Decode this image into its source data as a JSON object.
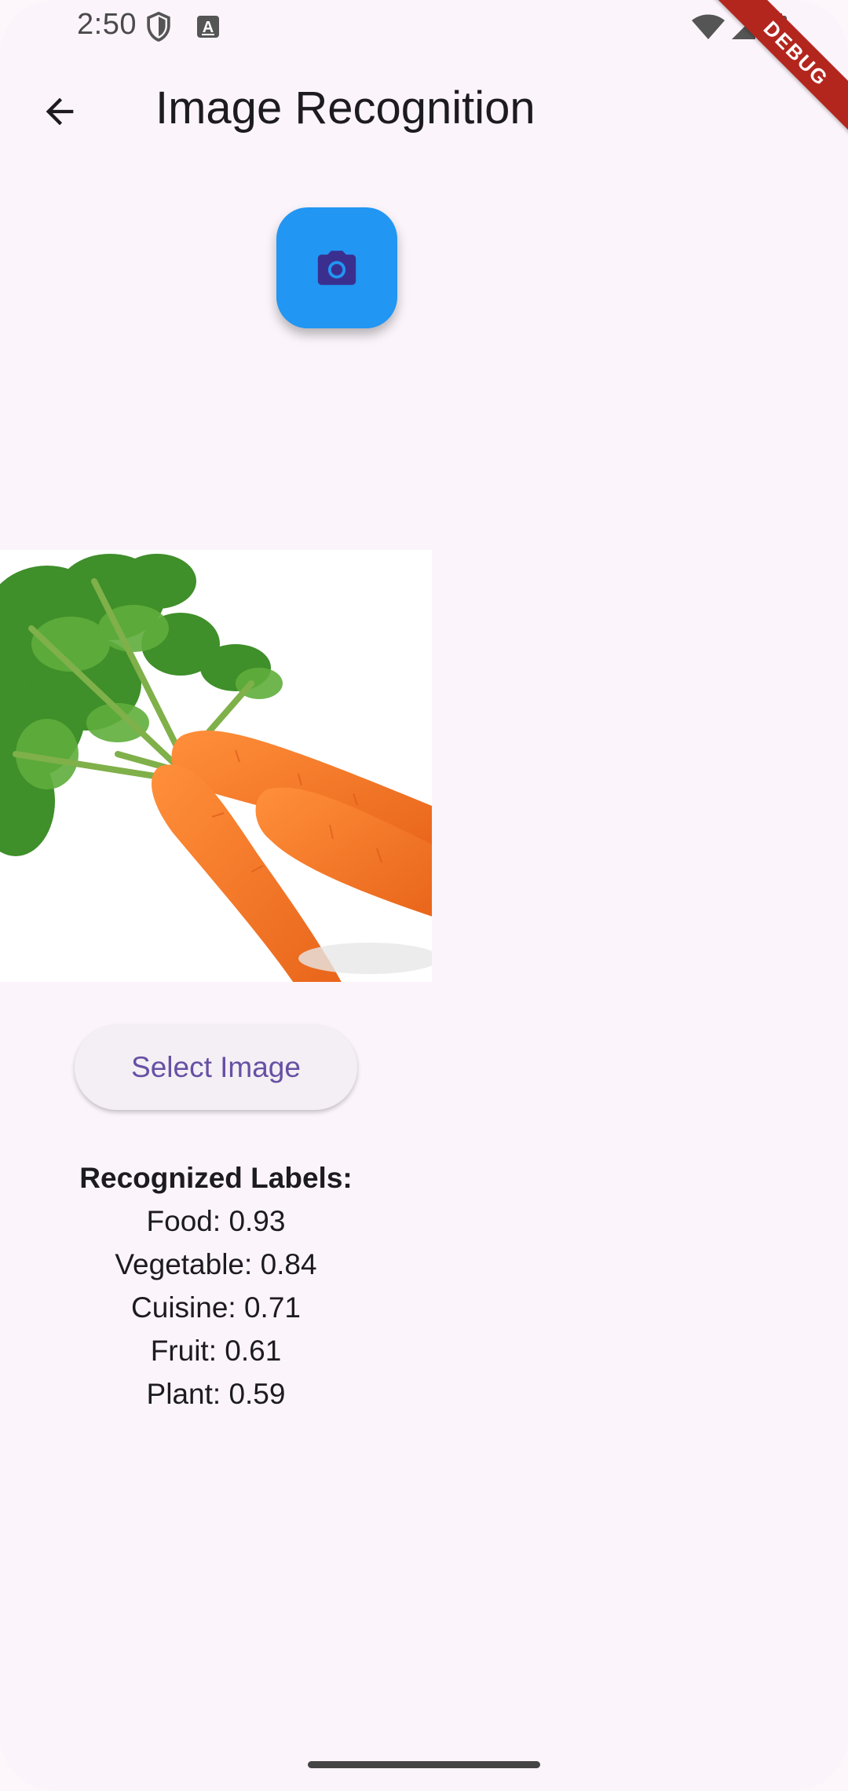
{
  "status_bar": {
    "time": "2:50",
    "icons": [
      "shield-icon",
      "a-icon",
      "wifi-icon",
      "signal-icon",
      "battery-icon"
    ]
  },
  "debug_banner": "DEBUG",
  "app_bar": {
    "title": "Image Recognition",
    "back_icon": "arrow-back-icon"
  },
  "camera_button": {
    "icon": "camera-icon",
    "color": "#2196f3"
  },
  "image": {
    "subject": "carrots"
  },
  "select_button": {
    "label": "Select Image"
  },
  "results": {
    "heading": "Recognized Labels:",
    "labels": [
      "Food: 0.93",
      "Vegetable: 0.84",
      "Cuisine: 0.71",
      "Fruit: 0.61",
      "Plant: 0.59"
    ]
  },
  "colors": {
    "background": "#fbf5fb",
    "accent": "#6750a4",
    "fab": "#2196f3"
  }
}
